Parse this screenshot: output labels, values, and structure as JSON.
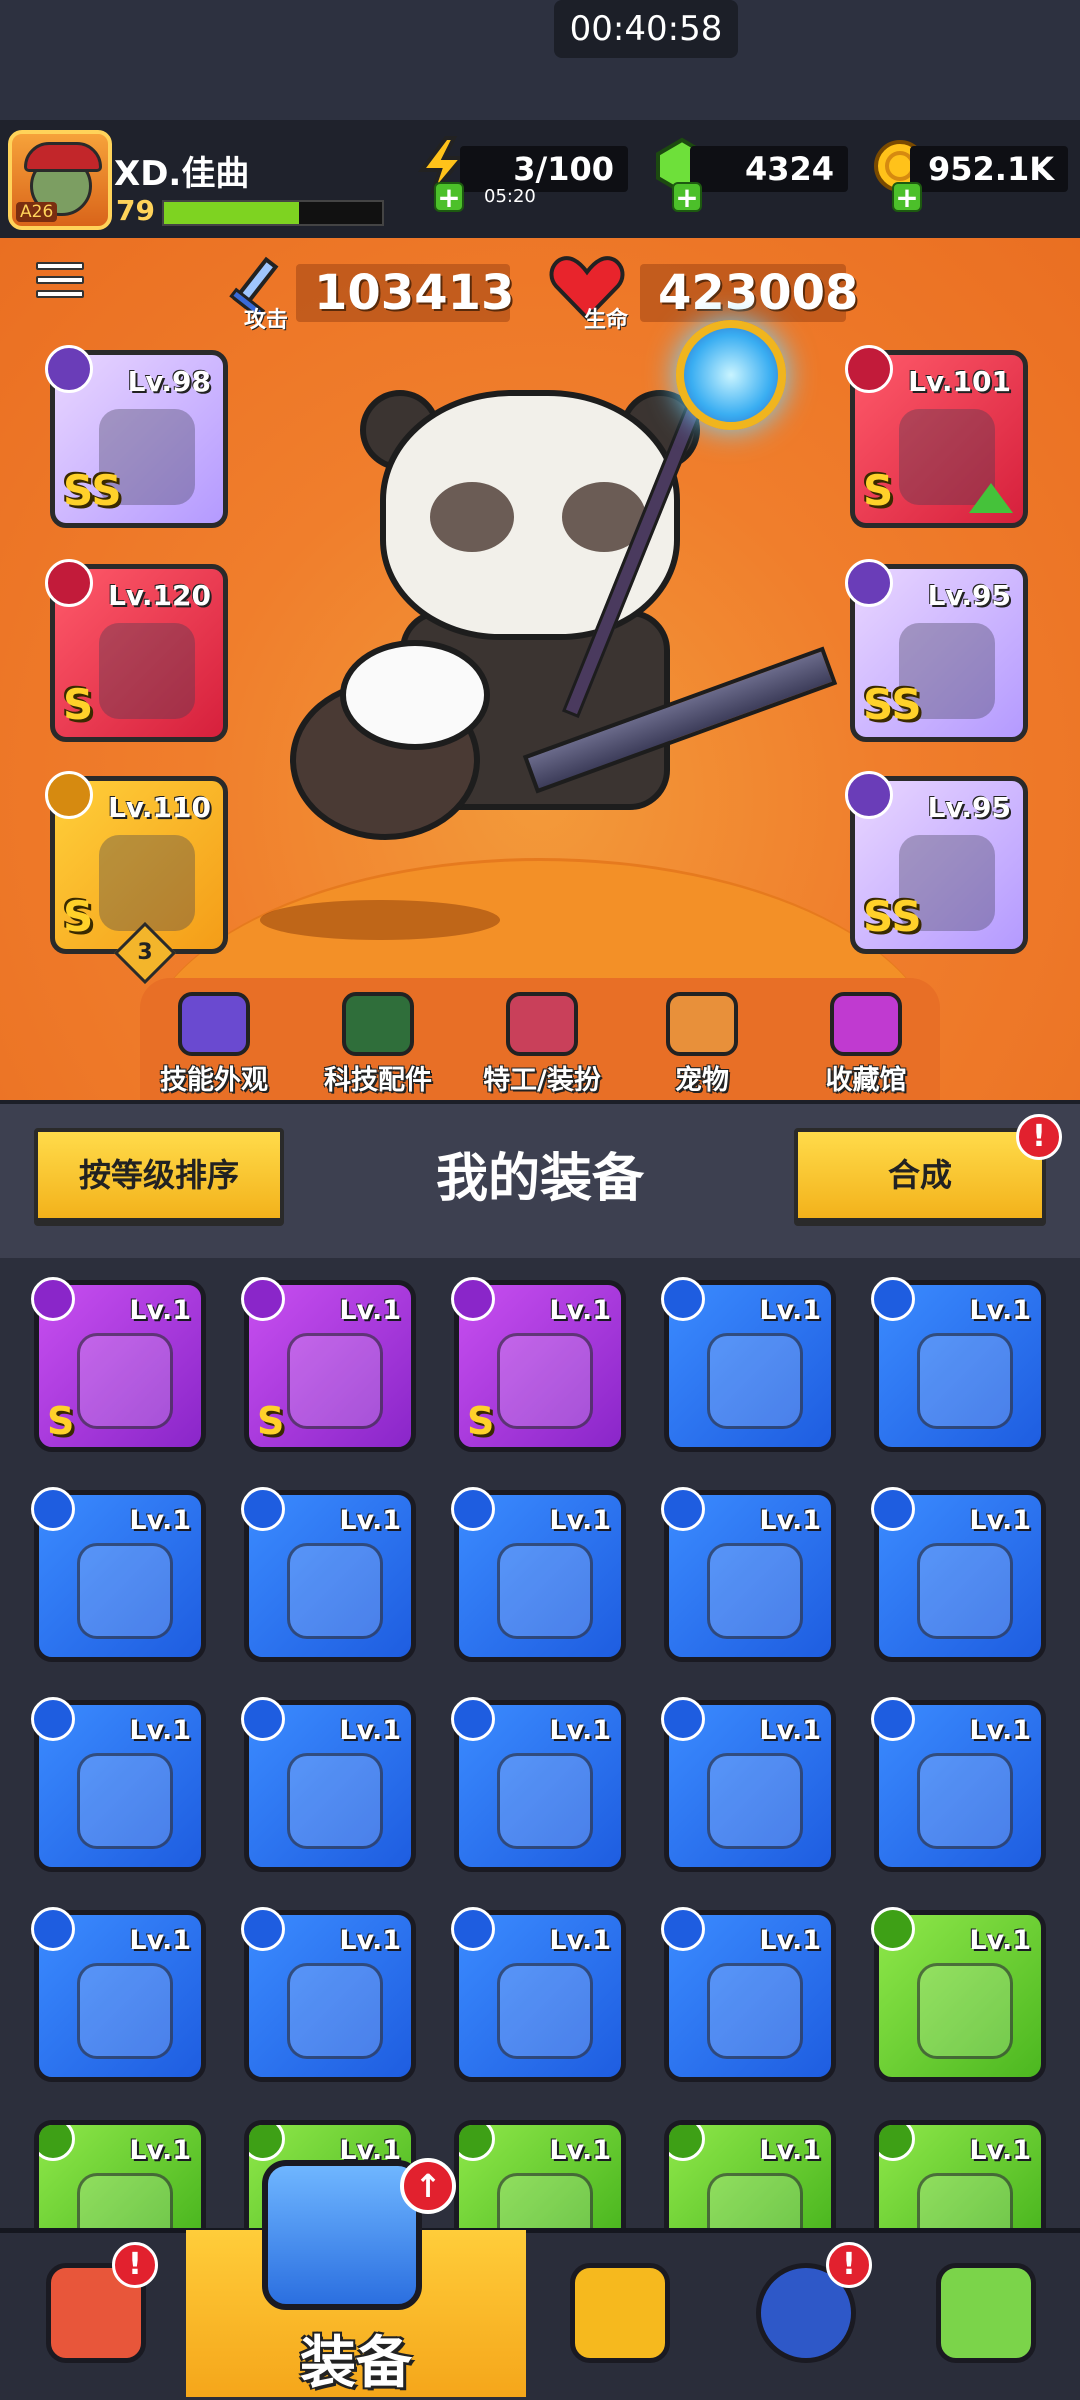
{
  "status_bar": {
    "time": "00:40:58"
  },
  "player": {
    "name": "XD.佳曲",
    "level": "79",
    "avatar_tag": "A26",
    "xp_progress": 0.62
  },
  "resources": {
    "energy": {
      "value": "3/100",
      "timer": "05:20",
      "icon": "lightning-icon"
    },
    "gems": {
      "value": "4324",
      "icon": "green-gem-icon"
    },
    "coins": {
      "value": "952.1K",
      "icon": "gold-coin-icon"
    }
  },
  "stats": {
    "attack": {
      "label": "攻击",
      "value": "103413",
      "icon": "sword-icon"
    },
    "health": {
      "label": "生命",
      "value": "423008",
      "icon": "heart-icon"
    }
  },
  "equipped": [
    {
      "slot": "weapon",
      "level": "Lv.98",
      "rank": "SS",
      "icon": "staff-icon"
    },
    {
      "slot": "armor",
      "level": "Lv.101",
      "rank": "S",
      "icon": "armor-icon",
      "upgrade": true
    },
    {
      "slot": "necklace",
      "level": "Lv.120",
      "rank": "S",
      "icon": "necklace-icon"
    },
    {
      "slot": "belt",
      "level": "Lv.95",
      "rank": "SS",
      "icon": "belt-icon"
    },
    {
      "slot": "gloves",
      "level": "Lv.110",
      "rank": "S",
      "icon": "gauntlet-icon",
      "badge": "3"
    },
    {
      "slot": "boots",
      "level": "Lv.95",
      "rank": "SS",
      "icon": "boots-icon"
    }
  ],
  "categories": [
    {
      "label": "技能外观",
      "icon": "skill-skin-icon"
    },
    {
      "label": "科技配件",
      "icon": "tech-part-icon"
    },
    {
      "label": "特工/装扮",
      "icon": "agent-icon"
    },
    {
      "label": "宠物",
      "icon": "pet-icon"
    },
    {
      "label": "收藏馆",
      "icon": "collection-icon"
    }
  ],
  "equipment_section": {
    "title": "我的装备",
    "sort_button": "按等级排序",
    "merge_button": "合成",
    "merge_alert": "!"
  },
  "inventory": [
    {
      "level": "Lv.1",
      "color": "purple",
      "rank": "S",
      "icon": "flame-sword-icon"
    },
    {
      "level": "Lv.1",
      "color": "purple",
      "rank": "S",
      "icon": "gun-icon"
    },
    {
      "level": "Lv.1",
      "color": "purple",
      "rank": "S",
      "icon": "gun-icon"
    },
    {
      "level": "Lv.1",
      "color": "blue",
      "rank": "",
      "icon": "gem-necklace-icon"
    },
    {
      "level": "Lv.1",
      "color": "blue",
      "rank": "",
      "icon": "belt-icon"
    },
    {
      "level": "Lv.1",
      "color": "blue",
      "rank": "",
      "icon": "leather-belt-icon"
    },
    {
      "level": "Lv.1",
      "color": "blue",
      "rank": "",
      "icon": "lightning-belt-icon"
    },
    {
      "level": "Lv.1",
      "color": "blue",
      "rank": "",
      "icon": "lightning-belt-icon"
    },
    {
      "level": "Lv.1",
      "color": "blue",
      "rank": "",
      "icon": "armor-belt-icon"
    },
    {
      "level": "Lv.1",
      "color": "blue",
      "rank": "",
      "icon": "armor-belt-icon"
    },
    {
      "level": "Lv.1",
      "color": "blue",
      "rank": "",
      "icon": "buckle-belt-icon"
    },
    {
      "level": "Lv.1",
      "color": "blue",
      "rank": "",
      "icon": "red-glove-icon"
    },
    {
      "level": "Lv.1",
      "color": "blue",
      "rank": "",
      "icon": "red-glove-icon"
    },
    {
      "level": "Lv.1",
      "color": "blue",
      "rank": "",
      "icon": "orange-glove-icon"
    },
    {
      "level": "Lv.1",
      "color": "blue",
      "rank": "",
      "icon": "blue-glove-icon"
    },
    {
      "level": "Lv.1",
      "color": "blue",
      "rank": "",
      "icon": "blue-glove-icon"
    },
    {
      "level": "Lv.1",
      "color": "blue",
      "rank": "",
      "icon": "tan-glove-icon"
    },
    {
      "level": "Lv.1",
      "color": "blue",
      "rank": "",
      "icon": "boot-icon"
    },
    {
      "level": "Lv.1",
      "color": "blue",
      "rank": "",
      "icon": "boot-icon"
    },
    {
      "level": "Lv.1",
      "color": "green",
      "rank": "",
      "icon": "kunai-icon"
    },
    {
      "level": "Lv.1",
      "color": "green",
      "rank": "",
      "icon": "kunai-icon"
    },
    {
      "level": "Lv.1",
      "color": "green",
      "rank": "",
      "icon": "kunai-icon"
    },
    {
      "level": "Lv.1",
      "color": "green",
      "rank": "",
      "icon": "blade-icon"
    },
    {
      "level": "Lv.1",
      "color": "green",
      "rank": "",
      "icon": "revolver-icon"
    },
    {
      "level": "Lv.1",
      "color": "green",
      "rank": "",
      "icon": "bat-icon"
    }
  ],
  "bottom_nav": [
    {
      "label": "",
      "icon": "shop-icon",
      "alert": "!"
    },
    {
      "label": "装备",
      "icon": "equipment-icon",
      "active": true,
      "upgrade": true
    },
    {
      "label": "",
      "icon": "star-swords-icon"
    },
    {
      "label": "",
      "icon": "star-ball-icon",
      "alert": "!"
    },
    {
      "label": "",
      "icon": "dna-capsule-icon"
    }
  ],
  "colors": {
    "hero_bg": "#f07e2c",
    "item_purple": "#8a26c9",
    "item_blue": "#1e5de0",
    "item_green": "#4cb720",
    "button_yellow": "#f3b21b",
    "alert_red": "#e2212e"
  }
}
